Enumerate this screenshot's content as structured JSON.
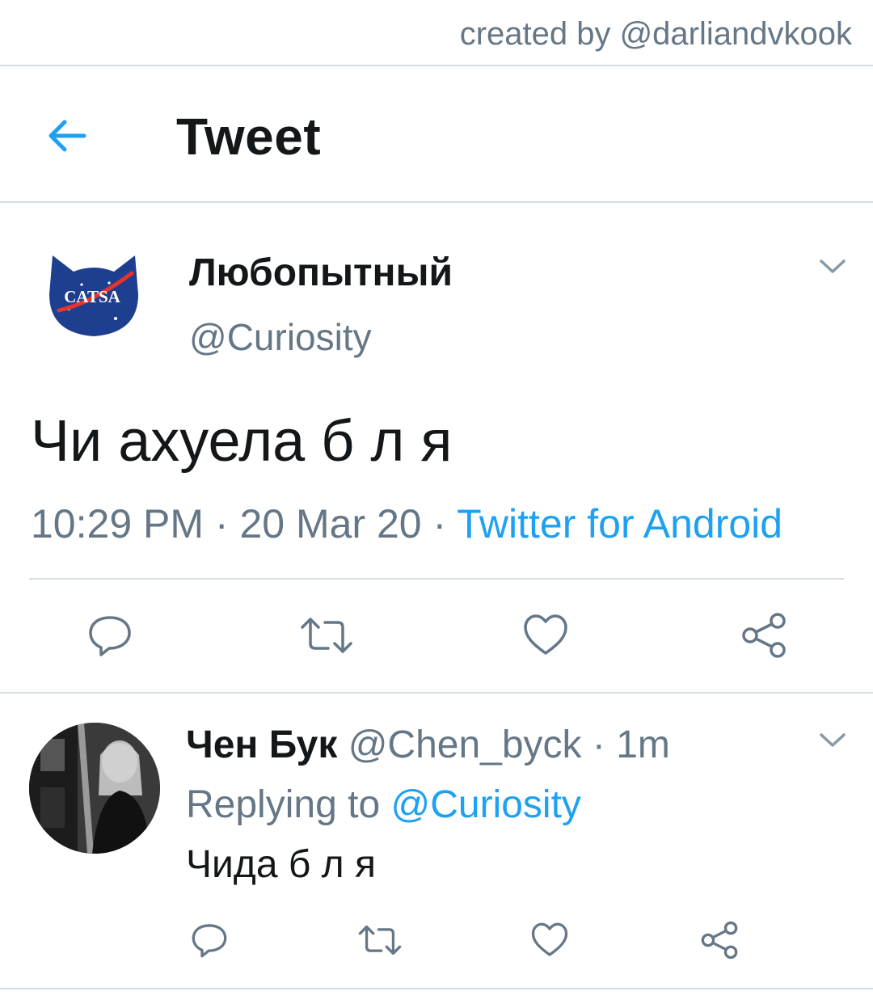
{
  "credit": "created by @darliandvkook",
  "header": {
    "title": "Tweet",
    "back_icon": "arrow-left-icon"
  },
  "tweet": {
    "display_name": "Любопытный",
    "handle": "@Curiosity",
    "avatar_text": "CATSA",
    "text": "Чи ахуела б л я",
    "time": "10:29 PM",
    "date": "20 Mar 20",
    "separator": " · ",
    "source": "Twitter for Android"
  },
  "reply": {
    "display_name": "Чен Бук",
    "handle": "@Chen_byck",
    "separator": " · ",
    "time": "1m",
    "replying_prefix": "Replying to ",
    "replying_mention": "@Curiosity",
    "text": "Чида б л я"
  },
  "colors": {
    "accent": "#1da1f2",
    "secondary_text": "#657786",
    "divider": "#d6dde3"
  },
  "icons": [
    "reply-icon",
    "retweet-icon",
    "like-icon",
    "share-icon",
    "chevron-down-icon"
  ]
}
